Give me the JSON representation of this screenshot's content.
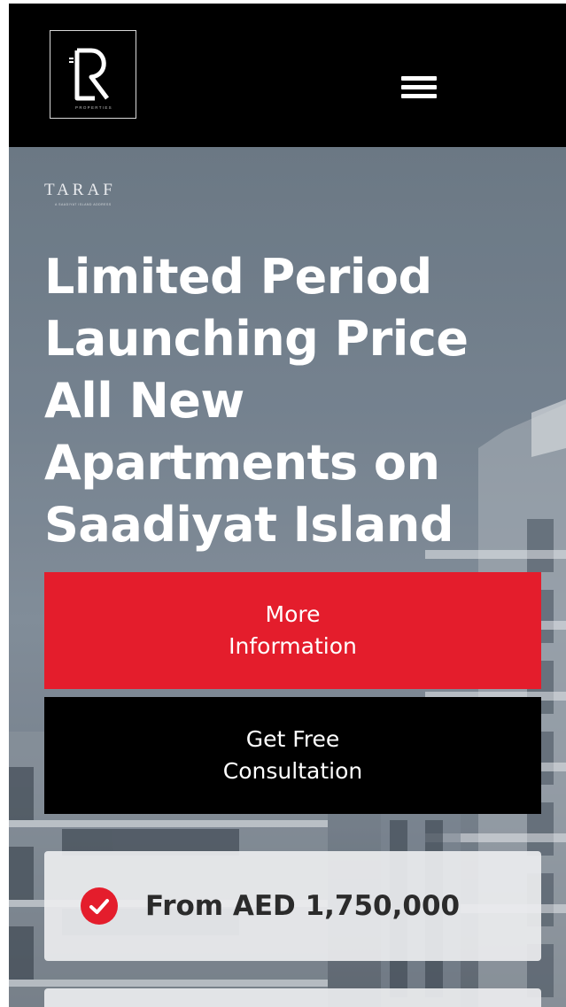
{
  "header": {
    "logo": {
      "monogram": "LR",
      "tagline": "PROPERTIES"
    },
    "menu_icon": "hamburger-menu-icon"
  },
  "hero": {
    "brand": {
      "name": "TARAF",
      "subtitle": "A SAADIYAT ISLAND ADDRESS"
    },
    "headline": "Limited Period Launching Price All New Apartments on Saadiyat Island",
    "buttons": {
      "more_info": "More Information",
      "consultation": "Get Free Consultation"
    },
    "features": [
      {
        "icon": "check-circle-icon",
        "text": "From AED 1,750,000"
      }
    ]
  },
  "colors": {
    "header_bg": "#000000",
    "accent_red": "#e41d2c",
    "button_dark": "#000000",
    "card_bg": "#ecedef",
    "text_white": "#ffffff"
  }
}
